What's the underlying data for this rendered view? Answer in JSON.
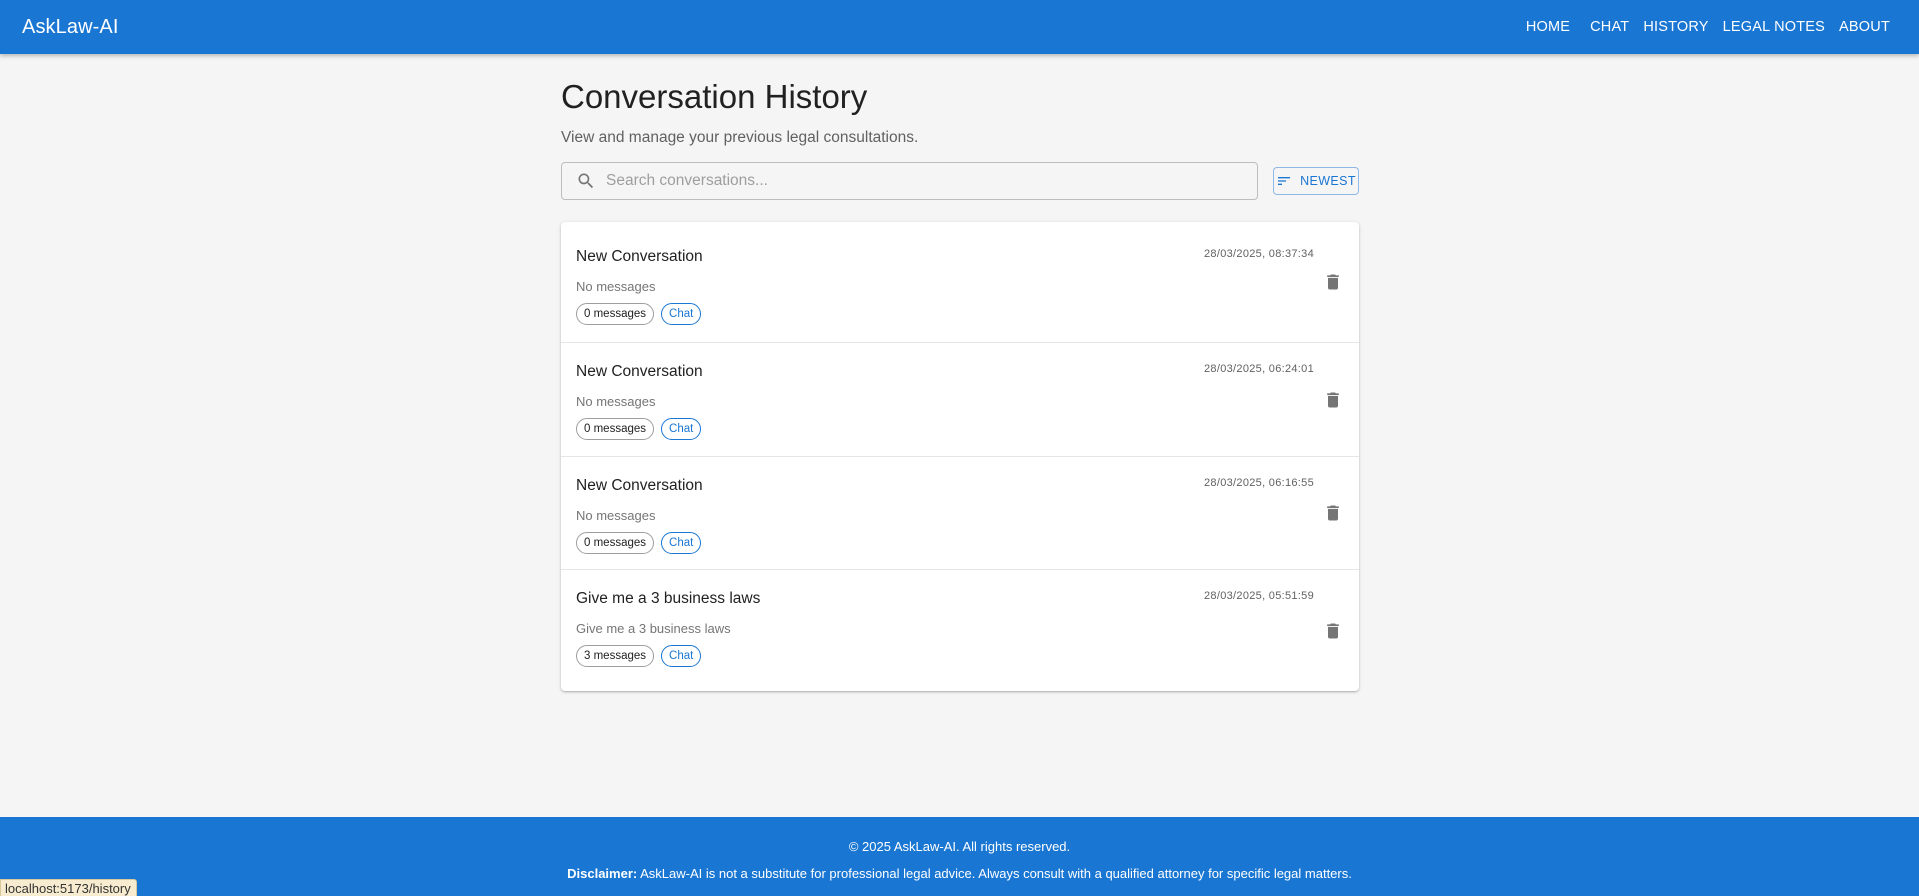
{
  "header": {
    "brand": "AskLaw-AI",
    "nav": [
      {
        "label": "HOME"
      },
      {
        "label": "CHAT"
      },
      {
        "label": "HISTORY"
      },
      {
        "label": "LEGAL NOTES"
      },
      {
        "label": "ABOUT"
      }
    ]
  },
  "page": {
    "title": "Conversation History",
    "subtitle": "View and manage your previous legal consultations."
  },
  "search": {
    "placeholder": "Search conversations...",
    "value": ""
  },
  "sort": {
    "label": "NEWEST"
  },
  "conversations": [
    {
      "title": "New Conversation",
      "timestamp": "28/03/2025, 08:37:34",
      "preview": "No messages",
      "count_label": "0 messages",
      "type_label": "Chat"
    },
    {
      "title": "New Conversation",
      "timestamp": "28/03/2025, 06:24:01",
      "preview": "No messages",
      "count_label": "0 messages",
      "type_label": "Chat"
    },
    {
      "title": "New Conversation",
      "timestamp": "28/03/2025, 06:16:55",
      "preview": "No messages",
      "count_label": "0 messages",
      "type_label": "Chat"
    },
    {
      "title": "Give me a 3 business laws",
      "timestamp": "28/03/2025, 05:51:59",
      "preview": "Give me a 3 business laws",
      "count_label": "3 messages",
      "type_label": "Chat"
    }
  ],
  "icons": {
    "search": "search-icon",
    "sort": "sort-lines-icon",
    "delete": "trash-icon"
  },
  "footer": {
    "copyright": "© 2025 AskLaw-AI. All rights reserved.",
    "disclaimer_label": "Disclaimer:",
    "disclaimer_text": " AskLaw-AI is not a substitute for professional legal advice. Always consult with a qualified attorney for specific legal matters."
  },
  "status_bar": {
    "url": "localhost:5173/history"
  },
  "colors": {
    "primary": "#1976d2",
    "background": "#f5f5f5",
    "surface": "#ffffff",
    "icon_gray": "#757575"
  }
}
